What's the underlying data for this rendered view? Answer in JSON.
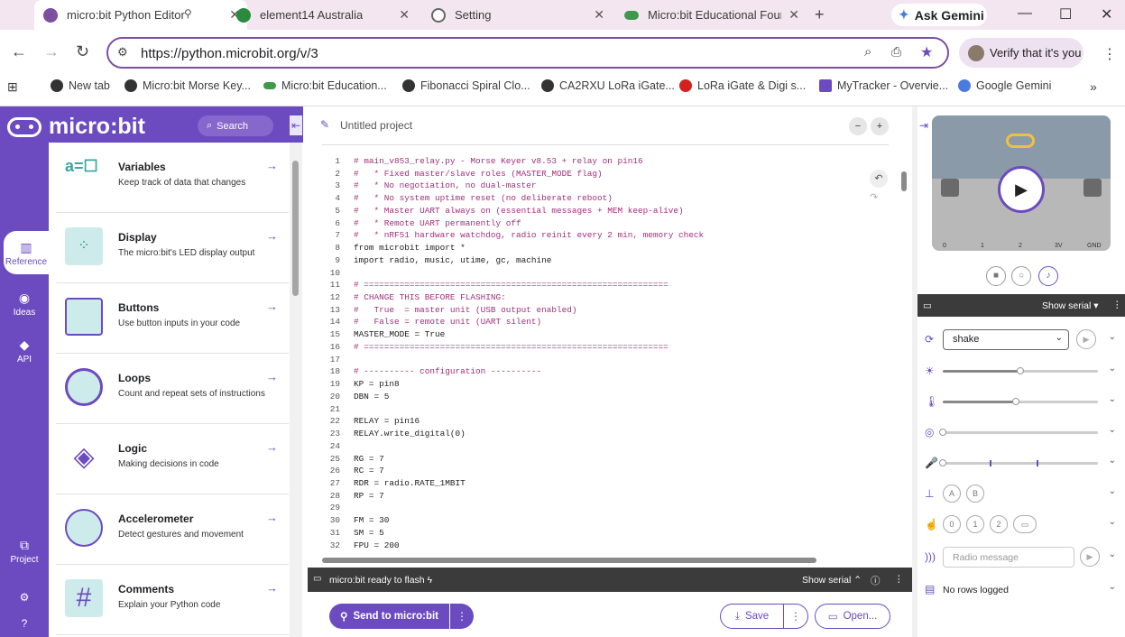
{
  "browser": {
    "tabs": [
      {
        "title": "micro:bit Python Editor",
        "active": true,
        "color": "#7e4ea1"
      },
      {
        "title": "element14 Australia",
        "active": false,
        "color": "#2a8a3e"
      },
      {
        "title": "Setting",
        "active": false,
        "color": "#666666"
      },
      {
        "title": "Micro:bit Educational Founda",
        "active": false,
        "color": "#3c9a4a"
      }
    ],
    "ask_gemini": "Ask Gemini",
    "url": "https://python.microbit.org/v/3",
    "verify": "Verify that it's you",
    "bookmarks": [
      "New tab",
      "Micro:bit Morse Key...",
      "Micro:bit Education...",
      "Fibonacci Spiral Clo...",
      "CA2RXU LoRa iGate...",
      "LoRa iGate & Digi s...",
      "MyTracker - Overvie...",
      "Google Gemini"
    ]
  },
  "app": {
    "logo": "micro:bit",
    "search": "Search",
    "rail": {
      "reference": "Reference",
      "ideas": "Ideas",
      "api": "API",
      "project": "Project"
    },
    "reference_items": [
      {
        "name": "Variables",
        "desc": "Keep track of data that changes"
      },
      {
        "name": "Display",
        "desc": "The micro:bit's LED display output"
      },
      {
        "name": "Buttons",
        "desc": "Use button inputs in your code"
      },
      {
        "name": "Loops",
        "desc": "Count and repeat sets of instructions"
      },
      {
        "name": "Logic",
        "desc": "Making decisions in code"
      },
      {
        "name": "Accelerometer",
        "desc": "Detect gestures and movement"
      },
      {
        "name": "Comments",
        "desc": "Explain your Python code"
      }
    ]
  },
  "editor": {
    "project_name": "Untitled project",
    "code_lines": [
      "# main_v853_relay.py - Morse Keyer v8.53 + relay on pin16",
      "#   * Fixed master/slave roles (MASTER_MODE flag)",
      "#   * No negotiation, no dual-master",
      "#   * No system uptime reset (no deliberate reboot)",
      "#   * Master UART always on (essential messages + MEM keep-alive)",
      "#   * Remote UART permanently off",
      "#   * nRF51 hardware watchdog, radio reinit every 2 min, memory check",
      "from microbit import *",
      "import radio, music, utime, gc, machine",
      "",
      "# ============================================================",
      "# CHANGE THIS BEFORE FLASHING:",
      "#   True  = master unit (USB output enabled)",
      "#   False = remote unit (UART silent)",
      "MASTER_MODE = True",
      "# ============================================================",
      "",
      "# ---------- configuration ----------",
      "KP = pin8",
      "DBN = 5",
      "",
      "RELAY = pin16",
      "RELAY.write_digital(0)",
      "",
      "RG = 7",
      "RC = 7",
      "RDR = radio.RATE_1MBIT",
      "RP = 7",
      "",
      "FM = 30",
      "SM = 5",
      "FPU = 200"
    ],
    "status": "micro:bit ready to flash",
    "show_serial": "Show serial",
    "send": "Send to micro:bit",
    "save": "Save",
    "open": "Open..."
  },
  "simulator": {
    "pins": [
      "0",
      "1",
      "2",
      "3V",
      "GND"
    ],
    "show_serial": "Show serial",
    "gesture": "shake",
    "buttons": [
      "A",
      "B"
    ],
    "touch_pins": [
      "0",
      "1",
      "2"
    ],
    "radio_placeholder": "Radio message",
    "log": "No rows logged",
    "levels": {
      "light": 0.5,
      "temperature": 0.47,
      "compass": 0.0,
      "sound": 0.0
    }
  }
}
